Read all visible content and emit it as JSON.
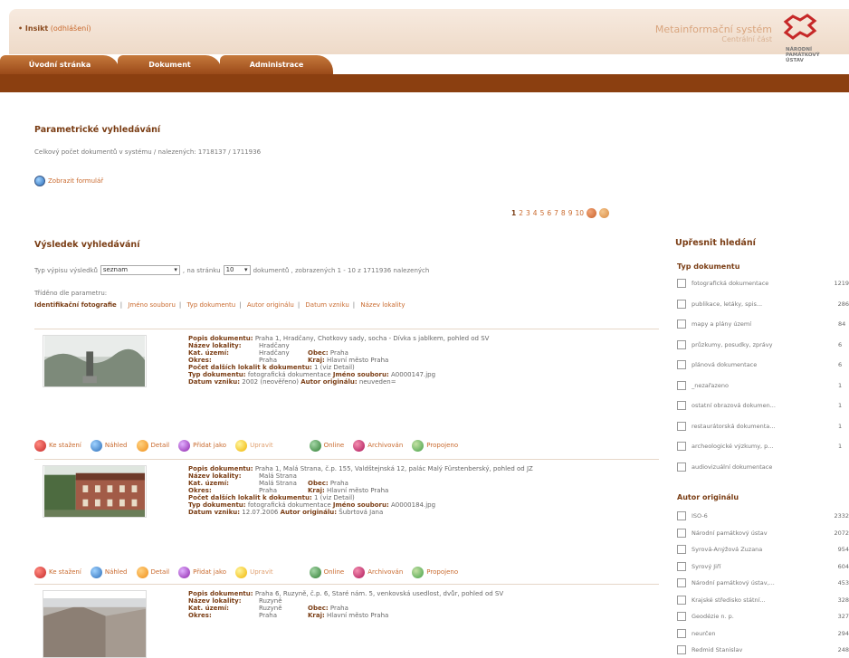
{
  "header": {
    "user_prefix": "• Insikt",
    "user_link": "(odhlášení)",
    "system_name": "Metainformační systém",
    "system_sub": "Centrální část",
    "logo_text": [
      "NÁRODNÍ",
      "PAMÁTKOVÝ",
      "ÚSTAV"
    ]
  },
  "tabs": [
    "Úvodní stránka",
    "Dokument",
    "Administrace"
  ],
  "page": {
    "title": "Parametrické vyhledávání",
    "count_text": "Celkový počet dokumentů v systému / nalezených: 1718137 / 1711936",
    "show_form": "Zobrazit formulář",
    "pages": [
      "1",
      "2",
      "3",
      "4",
      "5",
      "6",
      "7",
      "8",
      "9",
      "10"
    ]
  },
  "results": {
    "title": "Výsledek vyhledávání",
    "type_label": "Typ výpisu výsledků",
    "type_value": "seznam",
    "per_page_label": ", na stránku",
    "per_page_value": "10",
    "summary": "dokumentů , zobrazených 1 - 10 z 1711936 nalezených",
    "sort_label": "Tříděno dle parametru:",
    "sort_active": "Identifikační fotografie",
    "sort_options": [
      "Jméno souboru",
      "Typ dokumentu",
      "Autor originálu",
      "Datum vzniku",
      "Název lokality"
    ]
  },
  "labels": {
    "popis": "Popis dokumentu:",
    "nazev": "Název lokality:",
    "kat": "Kat. území:",
    "obec": "Obec:",
    "okres": "Okres:",
    "kraj": "Kraj:",
    "pocet": "Počet dalších lokalit k dokumentu:",
    "typ": "Typ dokumentu:",
    "jmeno": "Jméno souboru:",
    "datum": "Datum vzniku:",
    "autor": "Autor originálu:"
  },
  "actions": [
    "Ke stažení",
    "Náhled",
    "Detail",
    "Přidat jako",
    "Upravit",
    "Online",
    "Archivován",
    "Propojeno"
  ],
  "items": [
    {
      "popis": "Praha 1, Hradčany, Chotkovy sady, socha - Dívka s jablkem, pohled od SV",
      "nazev": "Hradčany",
      "kat": "Hradčany",
      "obec": "Praha",
      "okres": "Praha",
      "kraj": "Hlavní město Praha",
      "pocet": "1 (viz Detail)",
      "typ": "fotografická dokumentace",
      "jmeno": "A0000147.jpg",
      "datum": "2002 (neověřeno)",
      "autor": "neuveden="
    },
    {
      "popis": "Praha 1, Malá Strana, č.p. 155, Valdštejnská 12, palác Malý Fürstenberský, pohled od JZ",
      "nazev": "Malá Strana",
      "kat": "Malá Strana",
      "obec": "Praha",
      "okres": "Praha",
      "kraj": "Hlavní město Praha",
      "pocet": "1 (viz Detail)",
      "typ": "fotografická dokumentace",
      "jmeno": "A0000184.jpg",
      "datum": "12.07.2006",
      "autor": "Šubrtová Jana"
    },
    {
      "popis": "Praha 6, Ruzyně, č.p. 6, Staré nám. 5, venkovská usedlost, dvůr, pohled od SV",
      "nazev": "Ruzyně",
      "kat": "Ruzyně",
      "obec": "Praha",
      "okres": "Praha",
      "kraj": "Hlavní město Praha"
    }
  ],
  "refine": {
    "title": "Upřesnit hledání",
    "type_title": "Typ dokumentu",
    "types": [
      {
        "label": "fotografická dokumentace",
        "count": "1219"
      },
      {
        "label": "publikace, letáky, spis...",
        "count": "286"
      },
      {
        "label": "mapy a plány území",
        "count": "84"
      },
      {
        "label": "průzkumy, posudky, zprávy",
        "count": "6"
      },
      {
        "label": "plánová dokumentace",
        "count": "6"
      },
      {
        "label": "_nezařazeno",
        "count": "1"
      },
      {
        "label": "ostatní obrazová dokumen...",
        "count": "1"
      },
      {
        "label": "restaurátorská dokumenta...",
        "count": "1"
      },
      {
        "label": "archeologické výzkumy, p...",
        "count": "1"
      },
      {
        "label": "audiovizuální dokumentace",
        "count": ""
      }
    ],
    "author_title": "Autor originálu",
    "authors": [
      {
        "label": "ISO-6",
        "count": "2332"
      },
      {
        "label": "Národní památkový ústav",
        "count": "2072"
      },
      {
        "label": "Syrová-Anýžová Zuzana",
        "count": "954"
      },
      {
        "label": "Syrový Jiří",
        "count": "604"
      },
      {
        "label": "Národní památkový ústav,...",
        "count": "453"
      },
      {
        "label": "Krajské středisko státní...",
        "count": "328"
      },
      {
        "label": "Geodézie n. p.",
        "count": "327"
      },
      {
        "label": "neurčen",
        "count": "294"
      },
      {
        "label": "Redmid Stanislav",
        "count": "248"
      }
    ]
  },
  "colors": {
    "brand": "#8b3f10",
    "tab": "#b5622a",
    "link": "#c96a2e"
  }
}
